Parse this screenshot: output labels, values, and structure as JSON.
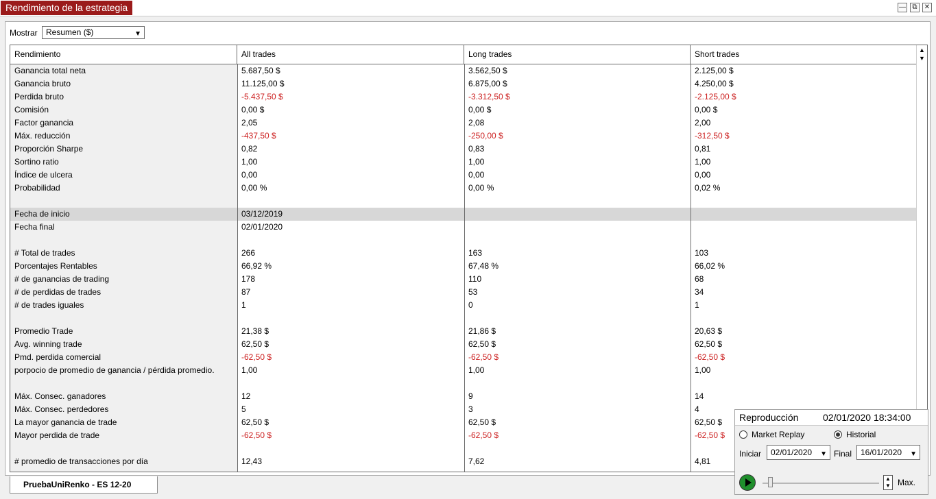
{
  "window": {
    "title": "Rendimiento de la estrategia",
    "controls": [
      "minimize-icon",
      "restore-icon",
      "close-icon"
    ]
  },
  "toolbar": {
    "show_label": "Mostrar",
    "show_value": "Resumen ($)"
  },
  "table": {
    "headers": [
      "Rendimiento",
      "All trades",
      "Long trades",
      "Short trades"
    ],
    "highlighted_row": "Fecha de inicio",
    "rows": [
      {
        "label": "Ganancia total neta",
        "all": "5.687,50 $",
        "long": "3.562,50 $",
        "short": "2.125,00 $"
      },
      {
        "label": "Ganancia bruto",
        "all": "11.125,00 $",
        "long": "6.875,00 $",
        "short": "4.250,00 $"
      },
      {
        "label": "Perdida bruto",
        "all": "-5.437,50 $",
        "long": "-3.312,50 $",
        "short": "-2.125,00 $"
      },
      {
        "label": "Comisión",
        "all": "0,00 $",
        "long": "0,00 $",
        "short": "0,00 $"
      },
      {
        "label": "Factor ganancia",
        "all": "2,05",
        "long": "2,08",
        "short": "2,00"
      },
      {
        "label": "Máx. reducción",
        "all": "-437,50 $",
        "long": "-250,00 $",
        "short": "-312,50 $"
      },
      {
        "label": "Proporción Sharpe",
        "all": "0,82",
        "long": "0,83",
        "short": "0,81"
      },
      {
        "label": "Sortino ratio",
        "all": "1,00",
        "long": "1,00",
        "short": "1,00"
      },
      {
        "label": "Índice de ulcera",
        "all": "0,00",
        "long": "0,00",
        "short": "0,00"
      },
      {
        "label": "Probabilidad",
        "all": "0,00 %",
        "long": "0,00 %",
        "short": "0,02 %"
      },
      {
        "label": "",
        "all": "",
        "long": "",
        "short": ""
      },
      {
        "label": "Fecha de inicio",
        "all": "03/12/2019",
        "long": "",
        "short": ""
      },
      {
        "label": "Fecha final",
        "all": "02/01/2020",
        "long": "",
        "short": ""
      },
      {
        "label": "",
        "all": "",
        "long": "",
        "short": ""
      },
      {
        "label": "# Total de trades",
        "all": "266",
        "long": "163",
        "short": "103"
      },
      {
        "label": "Porcentajes Rentables",
        "all": "66,92 %",
        "long": "67,48 %",
        "short": "66,02 %"
      },
      {
        "label": "# de ganancias de trading",
        "all": "178",
        "long": "110",
        "short": "68"
      },
      {
        "label": "# de perdidas de trades",
        "all": "87",
        "long": "53",
        "short": "34"
      },
      {
        "label": "# de trades iguales",
        "all": "1",
        "long": "0",
        "short": "1"
      },
      {
        "label": "",
        "all": "",
        "long": "",
        "short": ""
      },
      {
        "label": "Promedio Trade",
        "all": "21,38 $",
        "long": "21,86 $",
        "short": "20,63 $"
      },
      {
        "label": "Avg. winning trade",
        "all": "62,50 $",
        "long": "62,50 $",
        "short": "62,50 $"
      },
      {
        "label": "Pmd. perdida comercial",
        "all": "-62,50 $",
        "long": "-62,50 $",
        "short": "-62,50 $"
      },
      {
        "label": "porpocio de promedio de ganancia / pérdida promedio.",
        "all": "1,00",
        "long": "1,00",
        "short": "1,00"
      },
      {
        "label": "",
        "all": "",
        "long": "",
        "short": ""
      },
      {
        "label": "Máx. Consec. ganadores",
        "all": "12",
        "long": "9",
        "short": "14"
      },
      {
        "label": "Máx. Consec. perdedores",
        "all": "5",
        "long": "3",
        "short": "4"
      },
      {
        "label": "La mayor ganancia de trade",
        "all": "62,50 $",
        "long": "62,50 $",
        "short": "62,50 $"
      },
      {
        "label": "Mayor perdida de trade",
        "all": "-62,50 $",
        "long": "-62,50 $",
        "short": "-62,50 $"
      },
      {
        "label": "",
        "all": "",
        "long": "",
        "short": ""
      },
      {
        "label": "# promedio de transacciones por día",
        "all": "12,43",
        "long": "7,62",
        "short": "4,81"
      }
    ]
  },
  "bottom_tab": {
    "label": "PruebaUniRenko - ES 12-20"
  },
  "replay": {
    "title": "Reproducción",
    "time": "02/01/2020 18:34:00",
    "option_market_replay": "Market Replay",
    "option_historial": "Historial",
    "selected": "Historial",
    "start_label": "Iniciar",
    "start_value": "02/01/2020",
    "end_label": "Final",
    "end_value": "16/01/2020",
    "max_label": "Max.",
    "speed_position": 0.05
  },
  "colors": {
    "title_tab": "#9b1b1b",
    "negative": "#cc2020",
    "highlight_row": "#d7d7d7",
    "play_button": "#1f8f2c"
  }
}
